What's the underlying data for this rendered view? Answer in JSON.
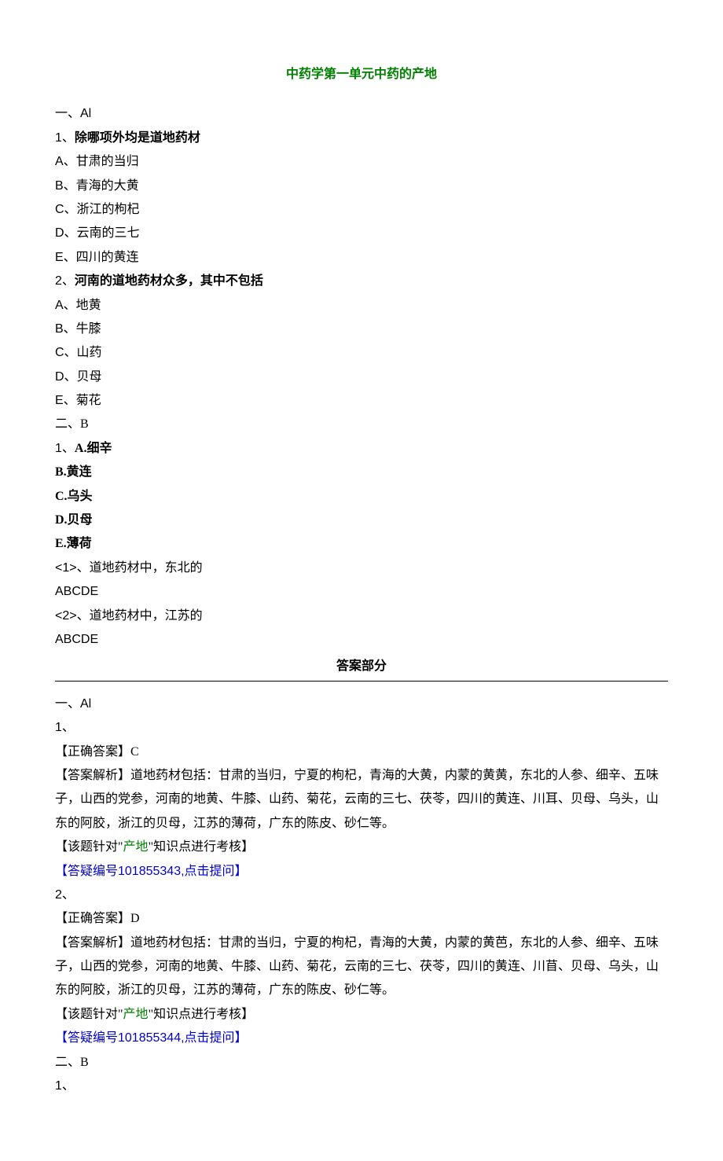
{
  "title": "中药学第一单元中药的产地",
  "sec1_head": "一、Al",
  "q1_stem_prefix": "1、",
  "q1_stem": "除哪项外均是道地药材",
  "q1_A": "A、甘肃的当归",
  "q1_B": "B、青海的大黄",
  "q1_C": "C、浙江的枸杞",
  "q1_D": "D、云南的三七",
  "q1_E": "E、四川的黄连",
  "q2_stem_prefix": "2、",
  "q2_stem": "河南的道地药材众多，其中不包括",
  "q2_A": "A、地黄",
  "q2_B": "B、牛膝",
  "q2_C": "C、山药",
  "q2_D": "D、贝母",
  "q2_E": "E、菊花",
  "sec2_head": "二、B",
  "b_prefix": "1、",
  "b_A": "A.细辛",
  "b_B": "B.黄连",
  "b_C": "C.乌头",
  "b_D": "D.贝母",
  "b_E": "E.薄荷",
  "sub1": "<1>、道地药材中，东北的",
  "opts1": "ABCDE",
  "sub2": "<2>、道地药材中，江苏的",
  "opts2": "ABCDE",
  "answer_header": "答案部分",
  "ans_sec1": "一、Al",
  "ans_q1_num": "1、",
  "ans_q1_correct": "【正确答案】C",
  "ans_q1_expl": "【答案解析】道地药材包括：甘肃的当归，宁夏的枸杞，青海的大黄，内蒙的黄黄，东北的人参、细辛、五味子，山西的党参，河南的地黄、牛膝、山药、菊花，云南的三七、茯苓，四川的黄连、川耳、贝母、乌头，山东的阿胶，浙江的贝母，江苏的薄荷，广东的陈皮、砂仁等。",
  "ans_q1_point_pre": "【该题针对\"",
  "ans_q1_point_green": "产地",
  "ans_q1_point_post": "\"知识点进行考核】",
  "ans_q1_link": "【答疑编号101855343,点击提问】",
  "ans_q2_num": "2、",
  "ans_q2_correct": "【正确答案】D",
  "ans_q2_expl": "【答案解析】道地药材包括：甘肃的当归，宁夏的枸杞，青海的大黄，内蒙的黄芭，东北的人参、细辛、五味子，山西的党参，河南的地黄、牛膝、山药、菊花，云南的三七、茯苓，四川的黄连、川苜、贝母、乌头，山东的阿胶，浙江的贝母，江苏的薄荷，广东的陈皮、砂仁等。",
  "ans_q2_point_pre": "【该题针对\"",
  "ans_q2_point_green": "产地",
  "ans_q2_point_post": "\"知识点进行考核】",
  "ans_q2_link": "【答疑编号101855344,点击提问】",
  "ans_sec2": "二、B",
  "ans_b1_num": "1、"
}
